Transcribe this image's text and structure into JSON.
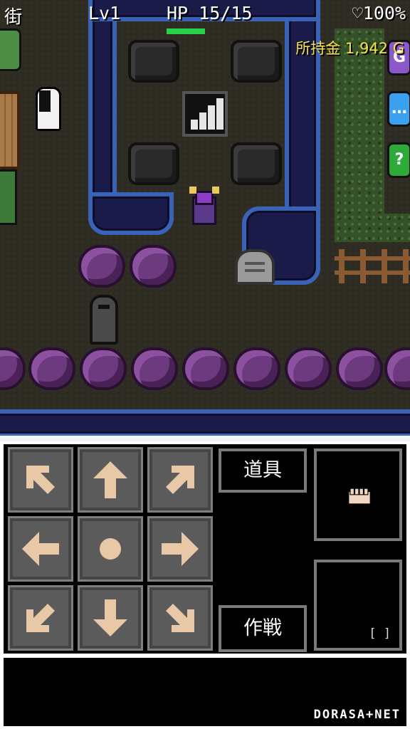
{
  "hud": {
    "location": "街",
    "level": "Lv1",
    "hp_label": "HP",
    "hp_value": "15/15",
    "hp_fraction": 1.0,
    "battery": "♡100%",
    "gold_label": "所持金",
    "gold_value": "1,942 G"
  },
  "side_icons": [
    {
      "name": "side-icon-purple",
      "glyph": "G",
      "color": "#8a58c8"
    },
    {
      "name": "side-icon-chat",
      "glyph": "…",
      "color": "#3aa0f0"
    },
    {
      "name": "side-icon-help",
      "glyph": "?",
      "color": "#2eaa3a"
    }
  ],
  "controls": {
    "dpad": [
      {
        "name": "move-up-left-button",
        "icon": "arrow-up-left-icon"
      },
      {
        "name": "move-up-button",
        "icon": "arrow-up-icon"
      },
      {
        "name": "move-up-right-button",
        "icon": "arrow-up-right-icon"
      },
      {
        "name": "move-left-button",
        "icon": "arrow-left-icon"
      },
      {
        "name": "wait-button",
        "icon": "dot-icon"
      },
      {
        "name": "move-right-button",
        "icon": "arrow-right-icon"
      },
      {
        "name": "move-down-left-button",
        "icon": "arrow-down-left-icon"
      },
      {
        "name": "move-down-button",
        "icon": "arrow-down-icon"
      },
      {
        "name": "move-down-right-button",
        "icon": "arrow-down-right-icon"
      }
    ],
    "items_label": "道具",
    "tactics_label": "作戦",
    "equip_slot_icon": "fist-icon",
    "sub_slot_label": "[ ]"
  },
  "footer": {
    "brand": "DORASA+NET"
  },
  "colors": {
    "arrow": "#e8c8a6",
    "button_face": "#5b5b5b",
    "hp_bar": "#27d14a",
    "gold_text": "#f6e04a",
    "water_border": "#3a63b8"
  }
}
